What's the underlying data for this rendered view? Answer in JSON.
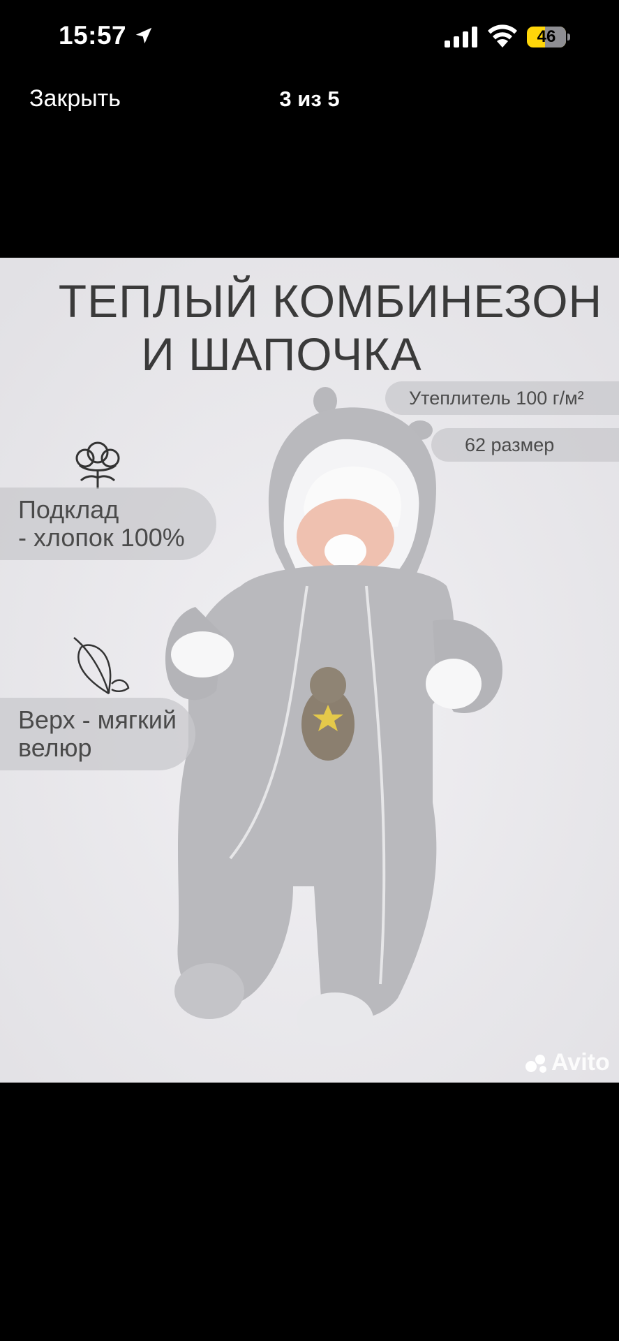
{
  "status_bar": {
    "time": "15:57",
    "battery": "46",
    "battery_level": 0.46,
    "icons": [
      "location-arrow-icon",
      "cellular-signal-icon",
      "wifi-icon",
      "battery-icon"
    ]
  },
  "nav": {
    "close_label": "Закрыть",
    "counter": "3 из 5"
  },
  "product_image": {
    "headline_line1": "ТЕПЛЫЙ КОМБИНЕЗОН",
    "headline_line2": "И ШАПОЧКА",
    "insulation_label": "Утеплитель 100 г/м²",
    "size_label": "62 размер",
    "lining_label_line1": "Подклад",
    "lining_label_line2": "- хлопок 100%",
    "top_label_line1": "Верх - мягкий",
    "top_label_line2": "велюр",
    "watermark": "Avito",
    "icons": [
      "cotton-flower-icon",
      "feather-icon",
      "avito-logo-icon"
    ]
  },
  "colors": {
    "background": "#000000",
    "photo_background": "#e9e8ec",
    "suit_gray": "#b9b9bd",
    "battery_yellow": "#ffd60a"
  }
}
